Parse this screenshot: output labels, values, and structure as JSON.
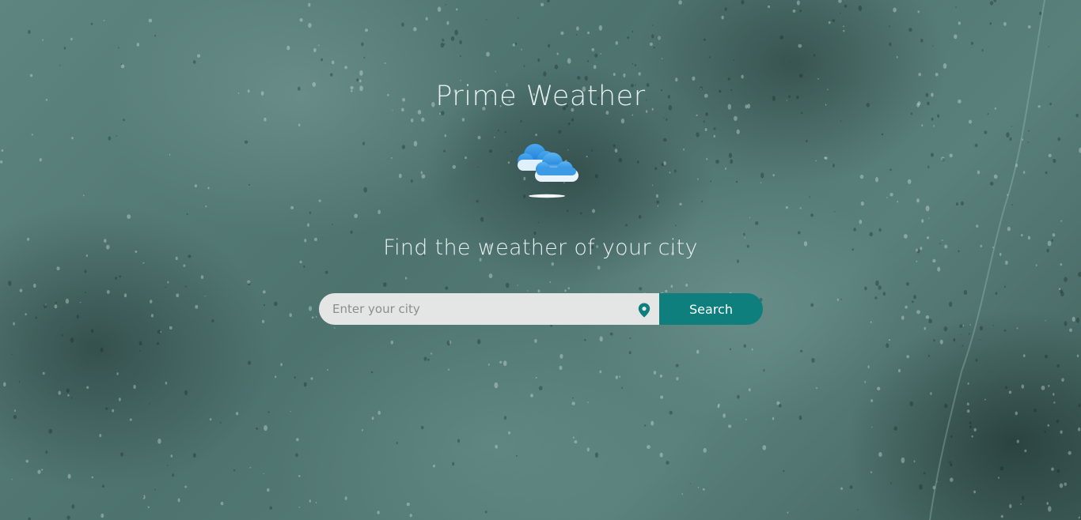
{
  "app": {
    "title": "Prime Weather",
    "subtitle": "Find the weather of your city"
  },
  "search": {
    "placeholder": "Enter your city",
    "value": "",
    "button_label": "Search"
  },
  "icons": {
    "weather": "cloudy-weather-icon",
    "location": "location-pin-icon"
  },
  "colors": {
    "accent": "#0e7f7c",
    "input_bg": "#e4e6e5",
    "text_light": "#e6efee"
  }
}
